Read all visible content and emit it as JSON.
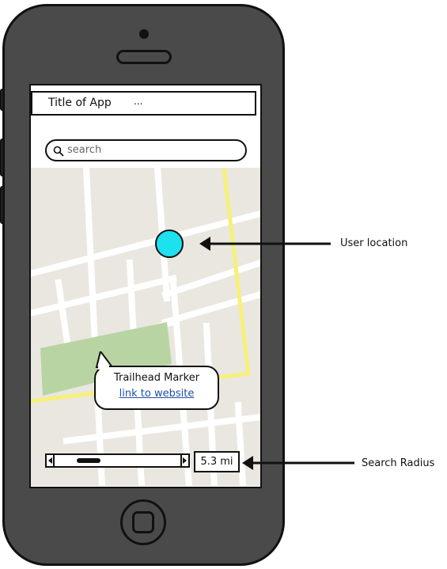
{
  "app": {
    "title": "Title of App",
    "title_more": "..."
  },
  "search": {
    "placeholder": "search"
  },
  "map": {
    "marker": {
      "title": "Trailhead Marker",
      "link": "link to website"
    },
    "user_location_color": "#1de1ee",
    "park_color": "#b8d4a3",
    "trail_color": "#f7f07a"
  },
  "radius": {
    "value": "5.3 mi"
  },
  "annotations": {
    "user_location": "User location",
    "search_radius": "Search Radius"
  },
  "icons": {
    "search": "search-icon",
    "slider_left": "arrow-left-icon",
    "slider_right": "arrow-right-icon"
  }
}
